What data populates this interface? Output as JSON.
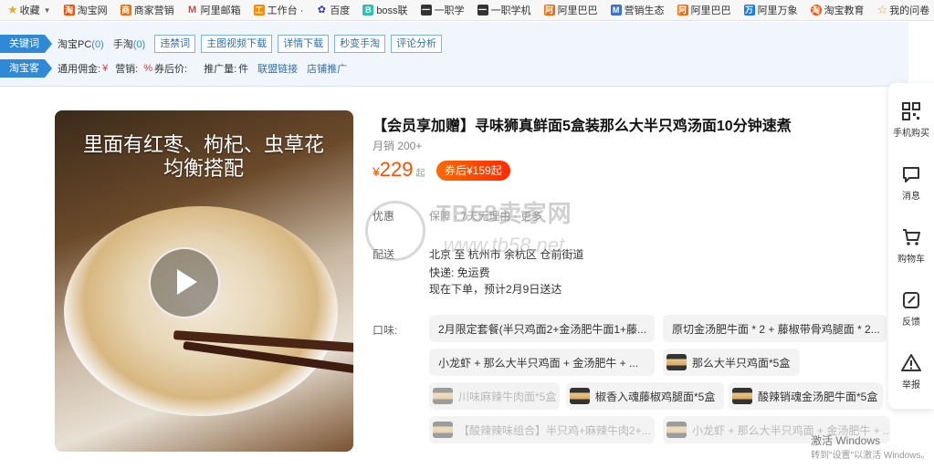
{
  "bookmarks": [
    {
      "label": "收藏",
      "color": "#f5a623"
    },
    {
      "label": "淘宝网",
      "color": "#ff5000"
    },
    {
      "label": "商家营销",
      "color": "#ff6a00"
    },
    {
      "label": "阿里邮箱",
      "color": "#e4393c"
    },
    {
      "label": "工作台 ·",
      "color": "#ff8a00"
    },
    {
      "label": "百度",
      "color": "#2932e1"
    },
    {
      "label": "boss联",
      "color": "#2bc2b3"
    },
    {
      "label": "一职学",
      "color": "#333333"
    },
    {
      "label": "一职学机",
      "color": "#333333"
    },
    {
      "label": "阿里巴巴",
      "color": "#ff6a00"
    },
    {
      "label": "营销生态",
      "color": "#3b6fd6"
    },
    {
      "label": "阿里巴巴",
      "color": "#ff6a00"
    },
    {
      "label": "阿里万象",
      "color": "#1677ff"
    },
    {
      "label": "淘宝教育",
      "color": "#ff5000"
    },
    {
      "label": "我的问卷",
      "color": "#f5a623"
    }
  ],
  "plugin": {
    "keyword_tag": "关键词",
    "taobao_pc": "淘宝PC",
    "taobao_pc_count": "(0)",
    "shoutao": "手淘",
    "shoutao_count": "(0)",
    "buttons": [
      "违禁词",
      "主图视频下载",
      "详情下载",
      "秒变手淘",
      "评论分析"
    ],
    "taoke_tag": "淘宝客",
    "commission_label": "通用佣金:",
    "commission_value": "¥",
    "sales_label": "营销:",
    "sales_value": "%",
    "coupon_label": "券后价:",
    "promo_label": "推广量:",
    "promo_value": "件",
    "links": [
      "联盟链接",
      "店铺推广"
    ]
  },
  "product": {
    "video_caption": "里面有红枣、枸杞、虫草花 均衡搭配",
    "title": "【会员享加赠】寻味狮真鲜面5盒装那么大半只鸡汤面10分钟速煮",
    "monthly_sales": "月销 200+",
    "price_currency": "¥",
    "price": "229",
    "price_suffix": "起",
    "coupon": "券后¥159起",
    "benefit_label": "优惠",
    "benefit_text": "保障 · 7天无理由 · 更多",
    "ship_label": "配送",
    "ship_from": "北京 至 杭州市 余杭区 仓前街道",
    "express": "快递: 免运费",
    "eta": "现在下单，预计2月9日送达",
    "flavor_label": "口味:",
    "options": [
      {
        "text": "2月限定套餐(半只鸡面2+金汤肥牛面1+藤...",
        "disabled": false,
        "thumb": false
      },
      {
        "text": "原切金汤肥牛面 * 2 + 藤椒带骨鸡腿面 * 2...",
        "disabled": false,
        "thumb": false
      },
      {
        "text": "小龙虾 + 那么大半只鸡面 + 金汤肥牛 + ...",
        "disabled": false,
        "thumb": false
      },
      {
        "text": "那么大半只鸡面*5盒",
        "disabled": false,
        "thumb": true
      },
      {
        "text": "川味麻辣牛肉面*5盒",
        "disabled": true,
        "thumb": true
      },
      {
        "text": "椒香入魂藤椒鸡腿面*5盒",
        "disabled": false,
        "thumb": true
      },
      {
        "text": "酸辣销魂金汤肥牛面*5盒",
        "disabled": false,
        "thumb": true
      },
      {
        "text": "【酸辣辣味组合】半只鸡+麻辣牛肉2+...",
        "disabled": true,
        "thumb": true
      },
      {
        "text": "小龙虾 + 那么大半只鸡面 + 金汤肥牛 + ...",
        "disabled": true,
        "thumb": true
      }
    ]
  },
  "watermark": {
    "brand": "TB58卖家网",
    "url": "www.tb58.net"
  },
  "side_bar": [
    {
      "label": "手机购买",
      "icon": "qrcode-icon"
    },
    {
      "label": "消息",
      "icon": "message-icon"
    },
    {
      "label": "购物车",
      "icon": "cart-icon"
    },
    {
      "label": "反馈",
      "icon": "edit-icon"
    },
    {
      "label": "举报",
      "icon": "warning-icon"
    }
  ],
  "windows_activation": {
    "line1": "激活 Windows",
    "line2": "转到\"设置\"以激活 Windows。"
  }
}
